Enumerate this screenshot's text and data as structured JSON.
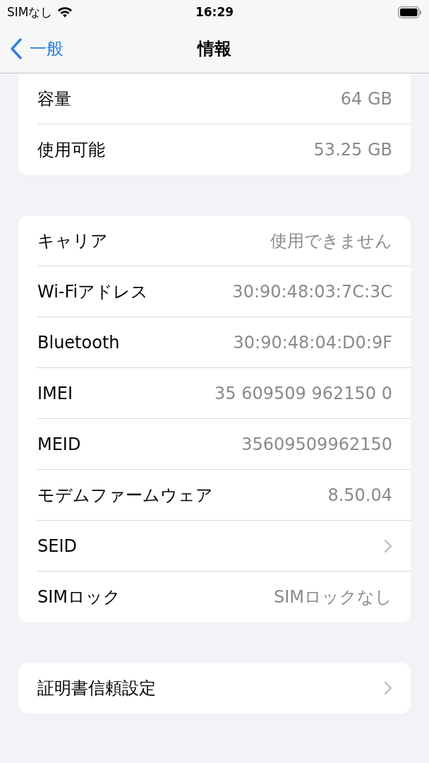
{
  "status_bar": {
    "carrier": "SIMなし",
    "time": "16:29"
  },
  "nav_bar": {
    "back": "一般",
    "title": "情報"
  },
  "groups": [
    {
      "rows": [
        {
          "kind": "value",
          "label": "容量",
          "value": "64 GB"
        },
        {
          "kind": "value",
          "label": "使用可能",
          "value": "53.25 GB"
        }
      ]
    },
    {
      "rows": [
        {
          "kind": "value",
          "label": "キャリア",
          "value": "使用できません"
        },
        {
          "kind": "value",
          "label": "Wi-Fiアドレス",
          "value": "30:90:48:03:7C:3C"
        },
        {
          "kind": "value",
          "label": "Bluetooth",
          "value": "30:90:48:04:D0:9F"
        },
        {
          "kind": "value",
          "label": "IMEI",
          "value": "35 609509 962150 0"
        },
        {
          "kind": "value",
          "label": "MEID",
          "value": "35609509962150"
        },
        {
          "kind": "value",
          "label": "モデムファームウェア",
          "value": "8.50.04"
        },
        {
          "kind": "link",
          "label": "SEID"
        },
        {
          "kind": "value",
          "label": "SIMロック",
          "value": "SIMロックなし"
        }
      ]
    },
    {
      "rows": [
        {
          "kind": "link",
          "label": "証明書信頼設定"
        }
      ]
    }
  ]
}
